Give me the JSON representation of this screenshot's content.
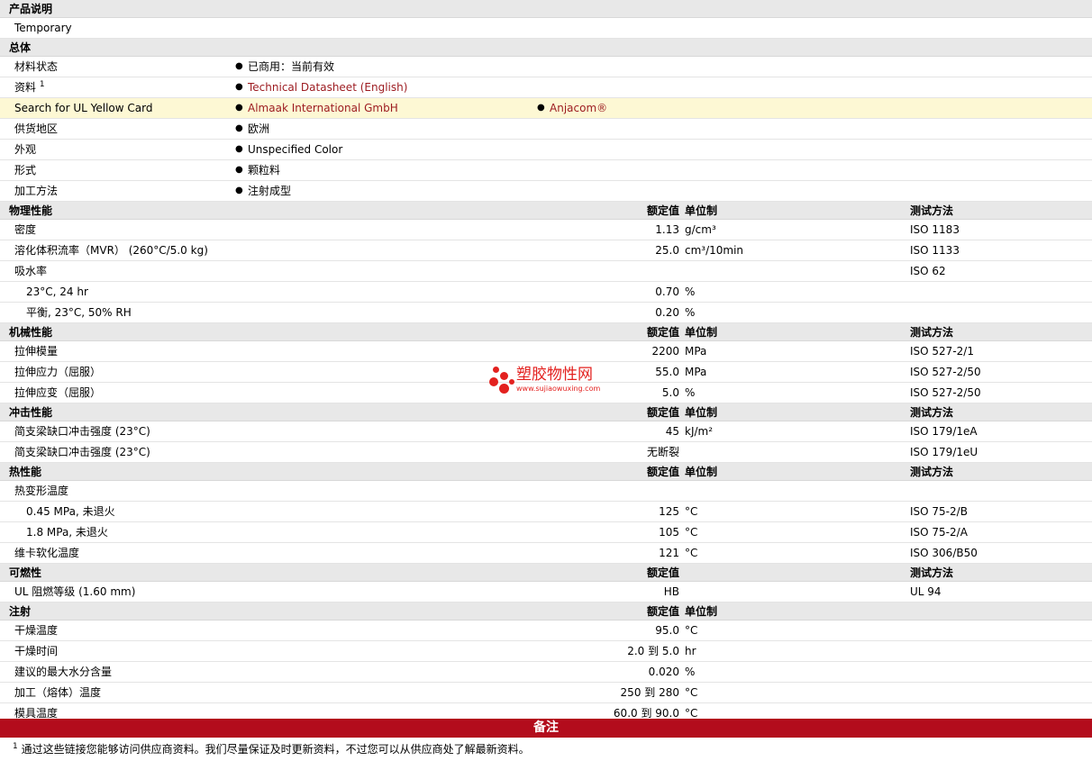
{
  "header": {
    "title": "产品说明",
    "desc": "Temporary"
  },
  "general": {
    "title": "总体",
    "rows": [
      {
        "label": "材料状态",
        "items": [
          "已商用：当前有效"
        ]
      },
      {
        "label": "资料",
        "sup": "1",
        "items": [
          "Technical Datasheet (English)"
        ],
        "link": true
      },
      {
        "label": "Search for UL Yellow Card",
        "items": [
          "Almaak International GmbH",
          "Anjacom®"
        ],
        "link": true,
        "highlight": true
      },
      {
        "label": "供货地区",
        "items": [
          "欧洲"
        ]
      },
      {
        "label": "外观",
        "items": [
          "Unspecified Color"
        ]
      },
      {
        "label": "形式",
        "items": [
          "颗粒料"
        ]
      },
      {
        "label": "加工方法",
        "items": [
          "注射成型"
        ]
      }
    ]
  },
  "columns": {
    "value": "额定值",
    "unit": "单位制",
    "test": "测试方法"
  },
  "bullet": "●",
  "physical": {
    "title": "物理性能",
    "rows": [
      {
        "label": "密度",
        "value": "1.13",
        "unit": "g/cm³",
        "test": "ISO 1183"
      },
      {
        "label": "溶化体积流率（MVR） (260°C/5.0 kg)",
        "value": "25.0",
        "unit": "cm³/10min",
        "test": "ISO 1133"
      },
      {
        "label": "吸水率",
        "value": "",
        "unit": "",
        "test": "ISO 62"
      },
      {
        "label": "23°C, 24 hr",
        "value": "0.70",
        "unit": "%",
        "test": "",
        "sub": true
      },
      {
        "label": "平衡, 23°C, 50% RH",
        "value": "0.20",
        "unit": "%",
        "test": "",
        "sub": true
      }
    ]
  },
  "mechanical": {
    "title": "机械性能",
    "rows": [
      {
        "label": "拉伸模量",
        "value": "2200",
        "unit": "MPa",
        "test": "ISO 527-2/1"
      },
      {
        "label": "拉伸应力（屈服）",
        "value": "55.0",
        "unit": "MPa",
        "test": "ISO 527-2/50"
      },
      {
        "label": "拉伸应变（屈服）",
        "value": "5.0",
        "unit": "%",
        "test": "ISO 527-2/50"
      }
    ]
  },
  "impact": {
    "title": "冲击性能",
    "rows": [
      {
        "label": "简支梁缺口冲击强度 (23°C)",
        "value": "45",
        "unit": "kJ/m²",
        "test": "ISO 179/1eA"
      },
      {
        "label": "简支梁缺口冲击强度 (23°C)",
        "value": "无断裂",
        "unit": "",
        "test": "ISO 179/1eU"
      }
    ]
  },
  "thermal": {
    "title": "热性能",
    "rows": [
      {
        "label": "热变形温度",
        "value": "",
        "unit": "",
        "test": ""
      },
      {
        "label": "0.45 MPa, 未退火",
        "value": "125",
        "unit": "°C",
        "test": "ISO 75-2/B",
        "sub": true
      },
      {
        "label": "1.8 MPa, 未退火",
        "value": "105",
        "unit": "°C",
        "test": "ISO 75-2/A",
        "sub": true
      },
      {
        "label": "维卡软化温度",
        "value": "121",
        "unit": "°C",
        "test": "ISO 306/B50"
      }
    ]
  },
  "flammability": {
    "title": "可燃性",
    "rows": [
      {
        "label": "UL 阻燃等级 (1.60 mm)",
        "value": "HB",
        "unit": "",
        "test": "UL 94"
      }
    ]
  },
  "injection": {
    "title": "注射",
    "rows": [
      {
        "label": "干燥温度",
        "value": "95.0",
        "unit": "°C",
        "test": ""
      },
      {
        "label": "干燥时间",
        "value": "2.0 到  5.0",
        "unit": "hr",
        "test": ""
      },
      {
        "label": "建议的最大水分含量",
        "value": "0.020",
        "unit": "%",
        "test": ""
      },
      {
        "label": "加工（熔体）温度",
        "value": "250 到  280",
        "unit": "°C",
        "test": ""
      },
      {
        "label": "模具温度",
        "value": "60.0 到  90.0",
        "unit": "°C",
        "test": ""
      }
    ]
  },
  "notes": {
    "title": "备注",
    "footnote_mark": "1",
    "footnote": "通过这些链接您能够访问供应商资料。我们尽量保证及时更新资料，不过您可以从供应商处了解最新资料。"
  },
  "watermark": {
    "title": "塑胶物性网",
    "url": "www.sujiaowuxing.com",
    "color": "#e3211f"
  },
  "colors": {
    "link": "#9c1a1f",
    "notes_bar": "#b30c1c",
    "section_bg": "#e8e8e8",
    "highlight_bg": "#fdf8d4"
  }
}
